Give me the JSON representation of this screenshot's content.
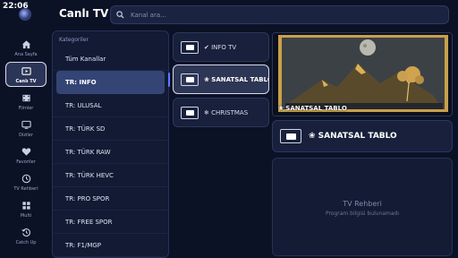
{
  "status": {
    "time": "22:06"
  },
  "header": {
    "title": "Canlı TV",
    "search_placeholder": "Kanal ara..."
  },
  "rail": [
    {
      "label": "Ana Sayfa",
      "icon": "home-icon"
    },
    {
      "label": "Canlı TV",
      "icon": "live-tv-icon",
      "active": true
    },
    {
      "label": "Filmler",
      "icon": "film-icon"
    },
    {
      "label": "Diziler",
      "icon": "monitor-icon"
    },
    {
      "label": "Favoriler",
      "icon": "heart-icon"
    },
    {
      "label": "TV Rehberi",
      "icon": "clock-icon"
    },
    {
      "label": "Multi",
      "icon": "grid-icon"
    },
    {
      "label": "Catch Up",
      "icon": "history-icon"
    }
  ],
  "categories": {
    "header": "Kategoriler",
    "items": [
      {
        "label": "Tüm Kanallar"
      },
      {
        "label": "TR: INFO",
        "active": true
      },
      {
        "label": "TR: ULUSAL"
      },
      {
        "label": "TR: TÜRK SD"
      },
      {
        "label": "TR: TÜRK RAW"
      },
      {
        "label": "TR: TÜRK HEVC"
      },
      {
        "label": "TR: PRO SPOR"
      },
      {
        "label": "TR: FREE SPOR"
      },
      {
        "label": "TR: F1/MGP"
      }
    ]
  },
  "channels": [
    {
      "name": "✔ INFO TV"
    },
    {
      "name": "❀ SANATSAL TABLO",
      "active": true
    },
    {
      "name": "❄ CHRISTMAS"
    }
  ],
  "preview": {
    "caption": "❀ SANATSAL TABLO"
  },
  "now_playing": {
    "name": "❀ SANATSAL TABLO"
  },
  "epg": {
    "title": "TV Rehberi",
    "message": "Program bilgisi bulunamadı"
  },
  "colors": {
    "background": "#0b1226",
    "accent": "#5a7bff",
    "active": "#344475"
  }
}
